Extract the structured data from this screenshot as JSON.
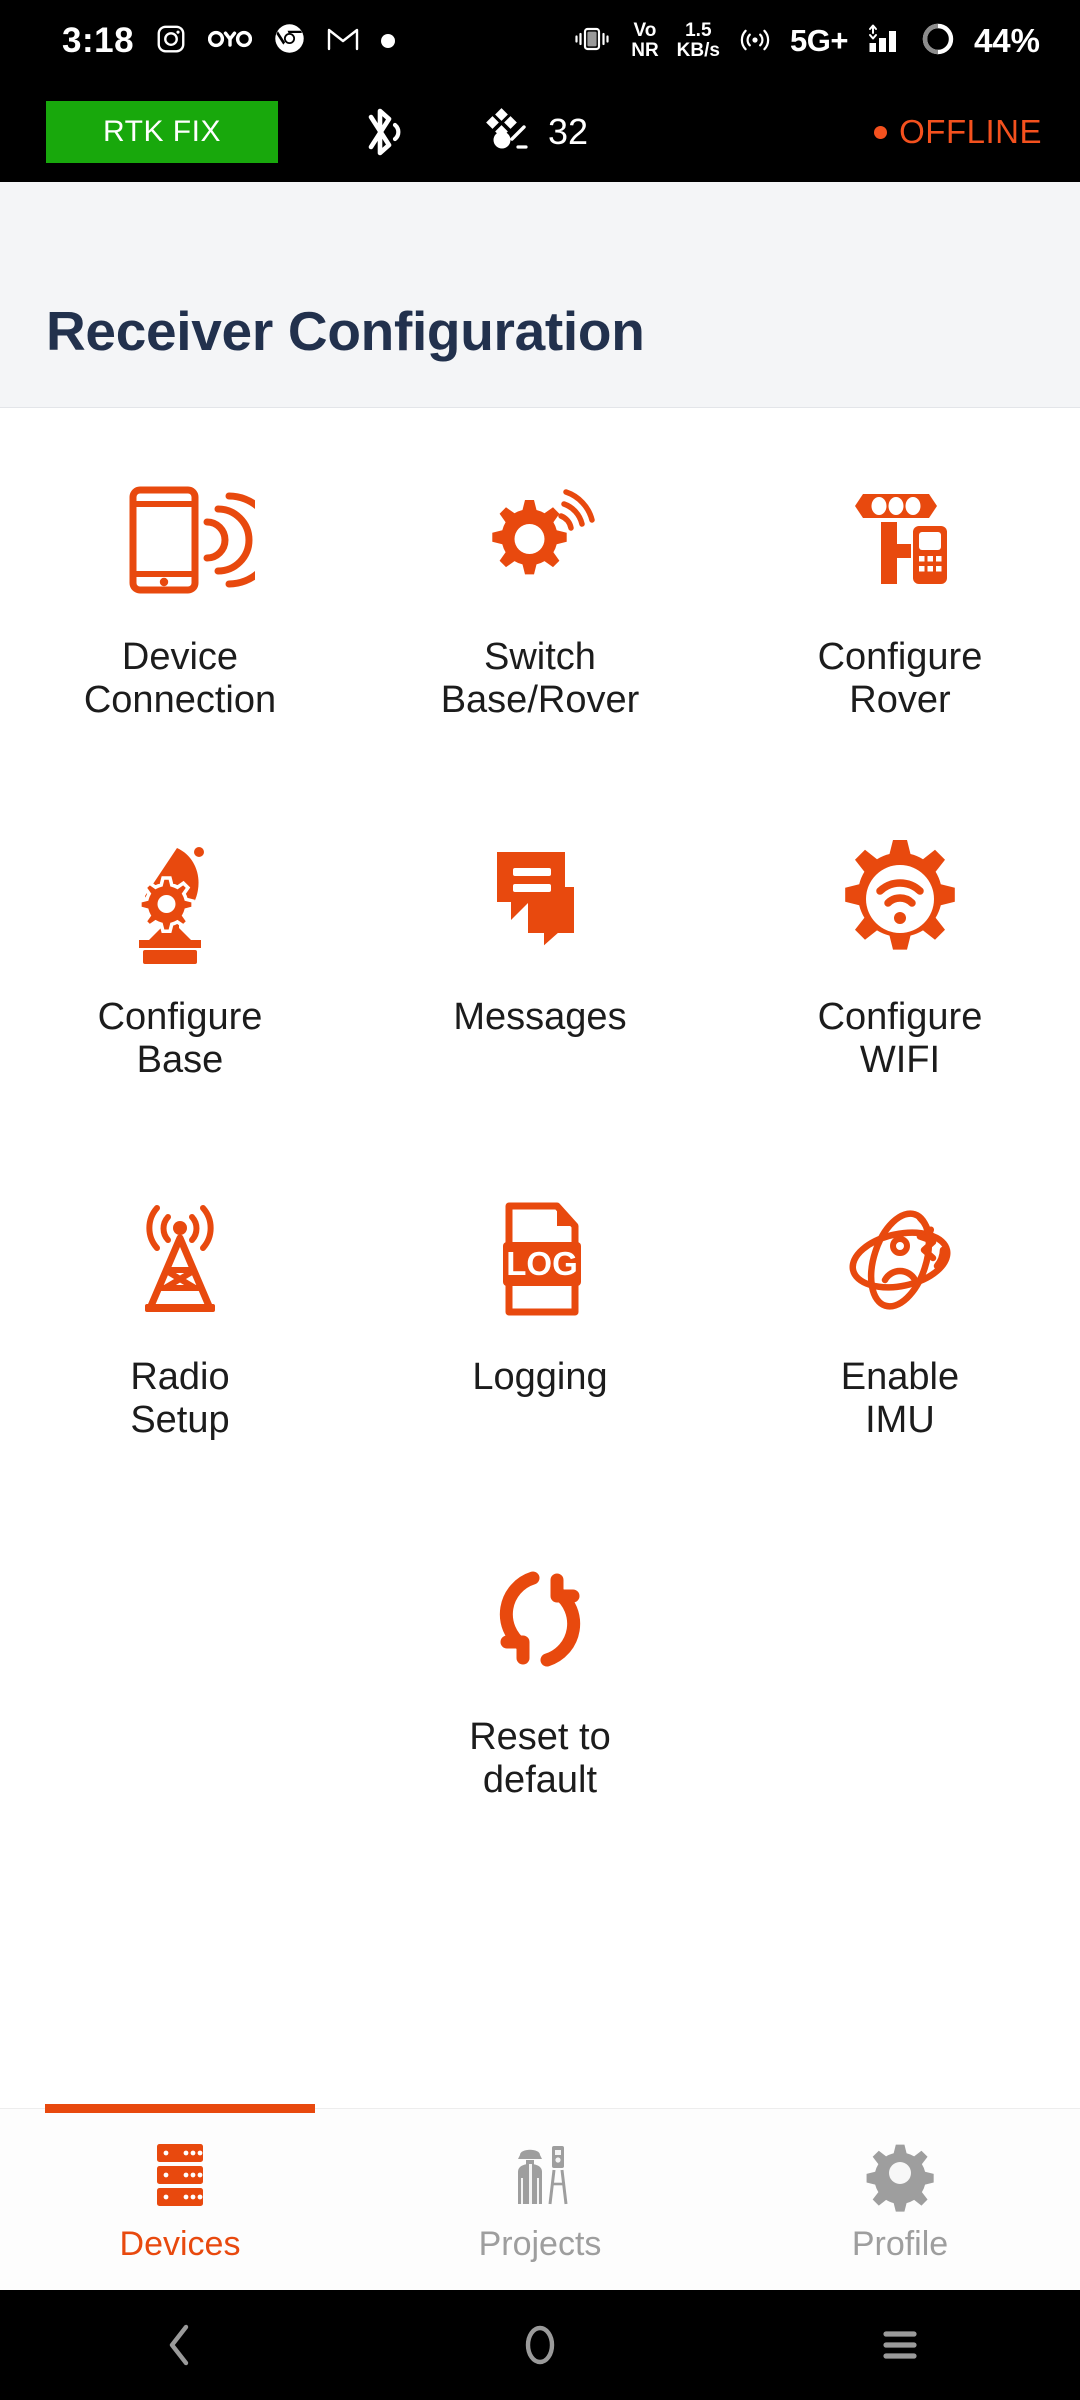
{
  "status_bar": {
    "time": "3:18",
    "left_icons": [
      "instagram-icon",
      "oyo-icon",
      "chrome-icon",
      "gmail-icon",
      "dot-icon"
    ],
    "vibrate_icon": "vibrate-icon",
    "volte_label_line1": "Vo",
    "volte_label_line2": "NR",
    "data_rate_line1": "1.5",
    "data_rate_line2": "KB/s",
    "hotspot_icon": "hotspot-icon",
    "network_type": "5G+",
    "signal_icon": "signal-bars-icon",
    "battery_icon": "battery-circle-icon",
    "battery_percent": "44%"
  },
  "app_status": {
    "rtk_status": "RTK FIX",
    "rtk_color": "#18a80c",
    "bluetooth_icon": "bluetooth-connected-icon",
    "satellite_icon": "satellite-icon",
    "satellite_count": "32",
    "connection_status": "OFFLINE",
    "connection_color": "#f4511e"
  },
  "header": {
    "title": "Receiver Configuration",
    "title_color": "#22314d",
    "background": "#f4f5f7"
  },
  "theme": {
    "accent": "#e8490e",
    "inactive": "#9e9e9e"
  },
  "grid": {
    "items": [
      {
        "icon": "device-connection-icon",
        "line1": "Device",
        "line2": "Connection"
      },
      {
        "icon": "switch-base-rover-icon",
        "line1": "Switch",
        "line2": "Base/Rover"
      },
      {
        "icon": "configure-rover-icon",
        "line1": "Configure",
        "line2": "Rover"
      },
      {
        "icon": "configure-base-icon",
        "line1": "Configure",
        "line2": "Base"
      },
      {
        "icon": "messages-icon",
        "line1": "Messages",
        "line2": ""
      },
      {
        "icon": "configure-wifi-icon",
        "line1": "Configure",
        "line2": "WIFI"
      },
      {
        "icon": "radio-setup-icon",
        "line1": "Radio",
        "line2": "Setup"
      },
      {
        "icon": "logging-icon",
        "line1": "Logging",
        "line2": ""
      },
      {
        "icon": "enable-imu-icon",
        "line1": "Enable",
        "line2": "IMU"
      },
      {
        "icon": "reset-to-default-icon",
        "line1": "Reset to",
        "line2": "default"
      }
    ],
    "logging_badge_text": "LOG"
  },
  "tab_bar": {
    "tabs": [
      {
        "icon": "devices-icon",
        "label": "Devices",
        "active": true
      },
      {
        "icon": "projects-icon",
        "label": "Projects",
        "active": false
      },
      {
        "icon": "profile-icon",
        "label": "Profile",
        "active": false
      }
    ]
  },
  "nav_bar": {
    "back": "back-icon",
    "home": "home-icon",
    "recents": "recents-icon"
  }
}
